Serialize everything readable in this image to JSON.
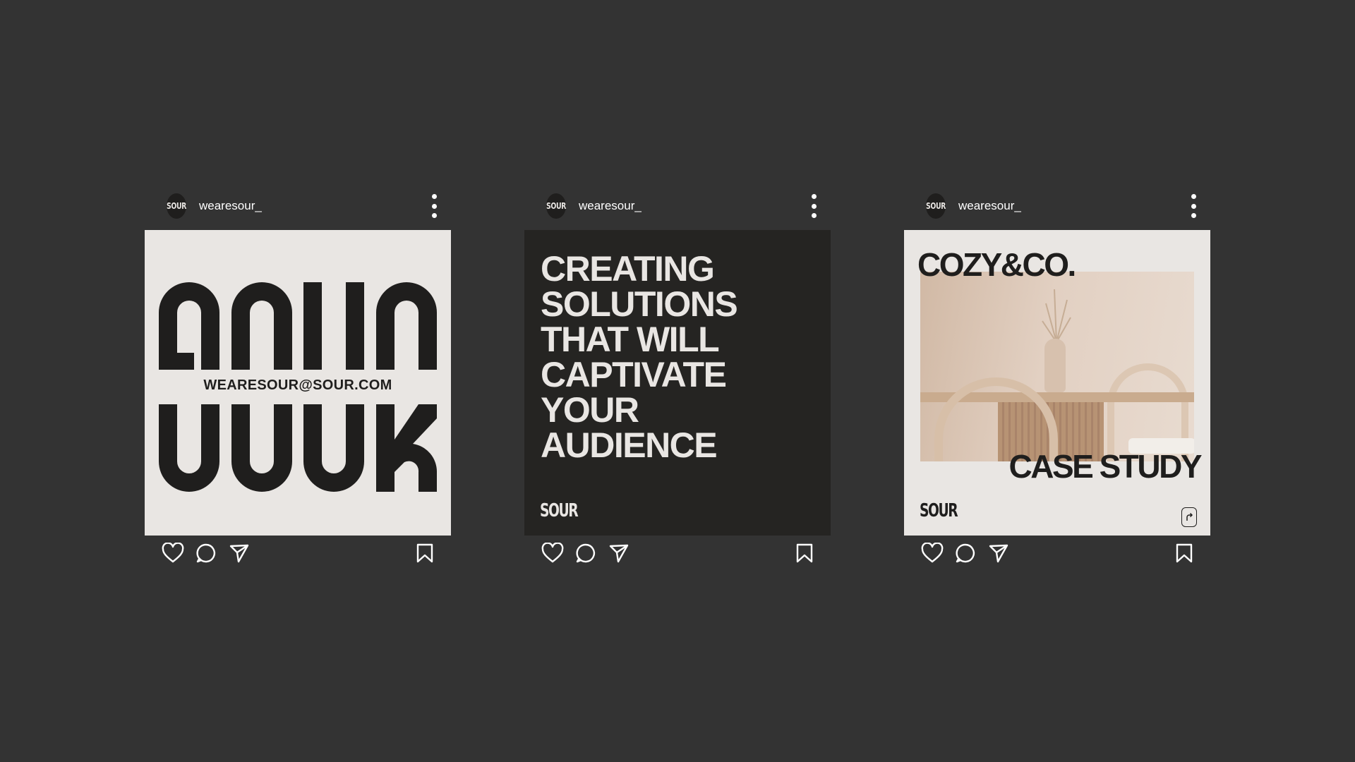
{
  "colors": {
    "background": "#333333",
    "card_light": "#e9e6e3",
    "card_dark": "#252422",
    "ink": "#1f1e1d",
    "icon": "#ffffff"
  },
  "posts": [
    {
      "username": "wearesour_",
      "avatar_text": "SOUR",
      "email": "WEARESOUR@SOUR.COM",
      "icons": [
        "more-vertical-icon",
        "heart-icon",
        "comment-icon",
        "send-icon",
        "bookmark-icon"
      ]
    },
    {
      "username": "wearesour_",
      "avatar_text": "SOUR",
      "headline": [
        "CREATING",
        "SOLUTIONS",
        "THAT WILL",
        "CAPTIVATE",
        "YOUR",
        "AUDIENCE"
      ],
      "brand": "SOUR",
      "icons": [
        "more-vertical-icon",
        "heart-icon",
        "comment-icon",
        "send-icon",
        "bookmark-icon"
      ]
    },
    {
      "username": "wearesour_",
      "avatar_text": "SOUR",
      "title": "COZY&CO.",
      "subtitle": "CASE STUDY",
      "brand": "SOUR",
      "icons": [
        "more-vertical-icon",
        "share-icon",
        "heart-icon",
        "comment-icon",
        "send-icon",
        "bookmark-icon"
      ]
    }
  ]
}
